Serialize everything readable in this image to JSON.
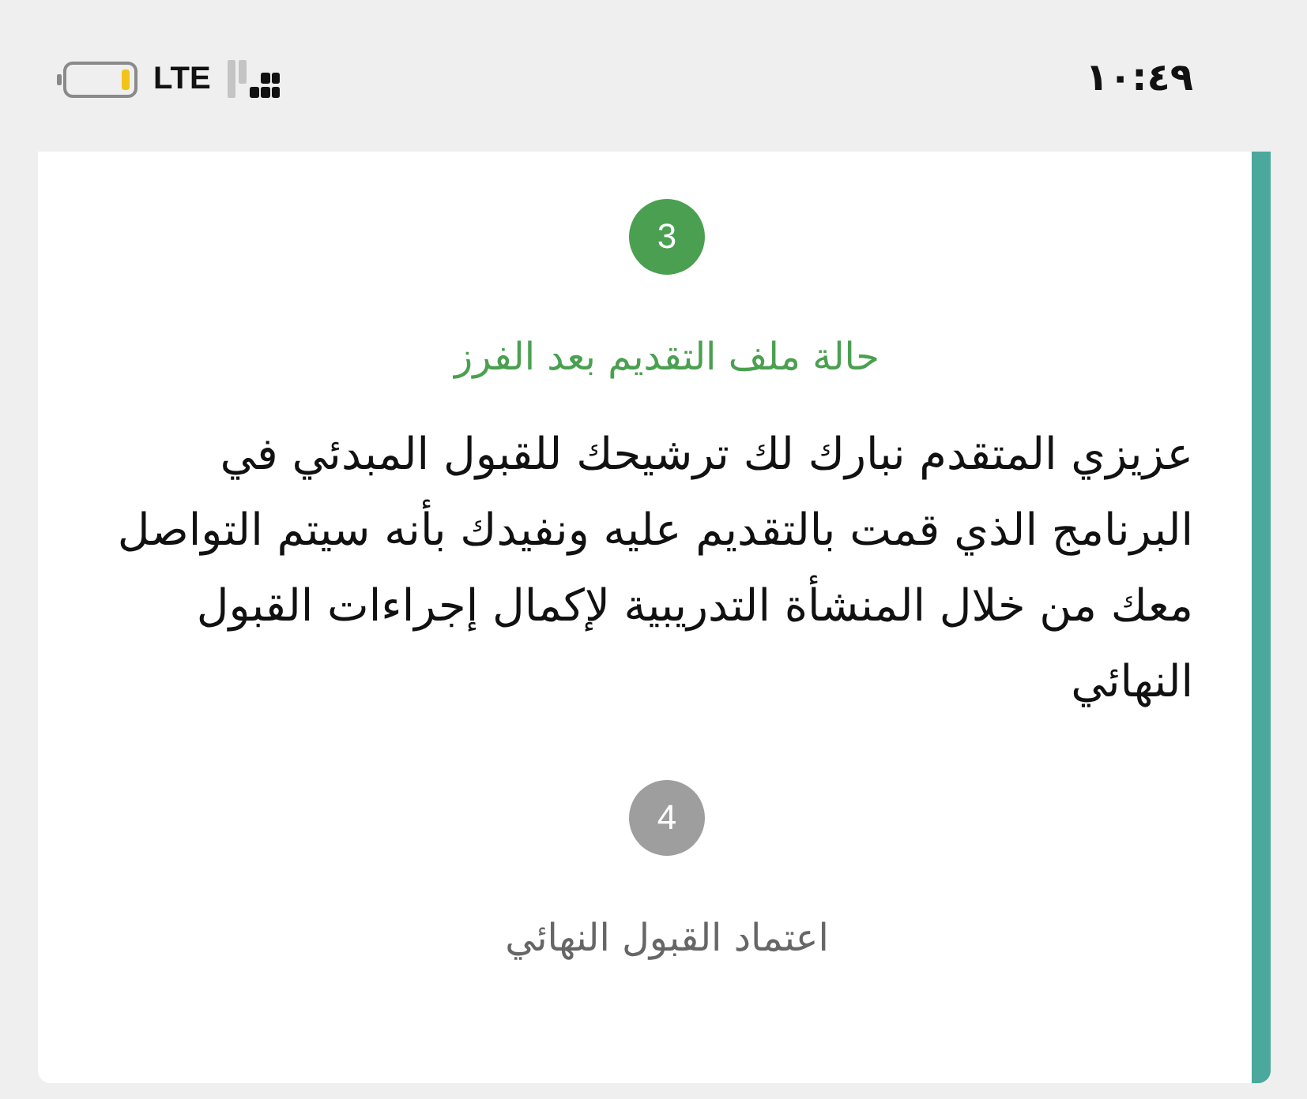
{
  "status_bar": {
    "time": "١٠:٤٩",
    "network": "LTE"
  },
  "steps": [
    {
      "number": "3",
      "title": "حالة ملف التقديم بعد الفرز",
      "active": true,
      "description": "عزيزي المتقدم نبارك لك ترشيحك للقبول المبدئي في البرنامج الذي قمت بالتقديم عليه ونفيدك بأنه سيتم التواصل معك من خلال المنشأة التدريبية لإكمال إجراءات القبول النهائي"
    },
    {
      "number": "4",
      "title": "اعتماد القبول النهائي",
      "active": false
    }
  ]
}
